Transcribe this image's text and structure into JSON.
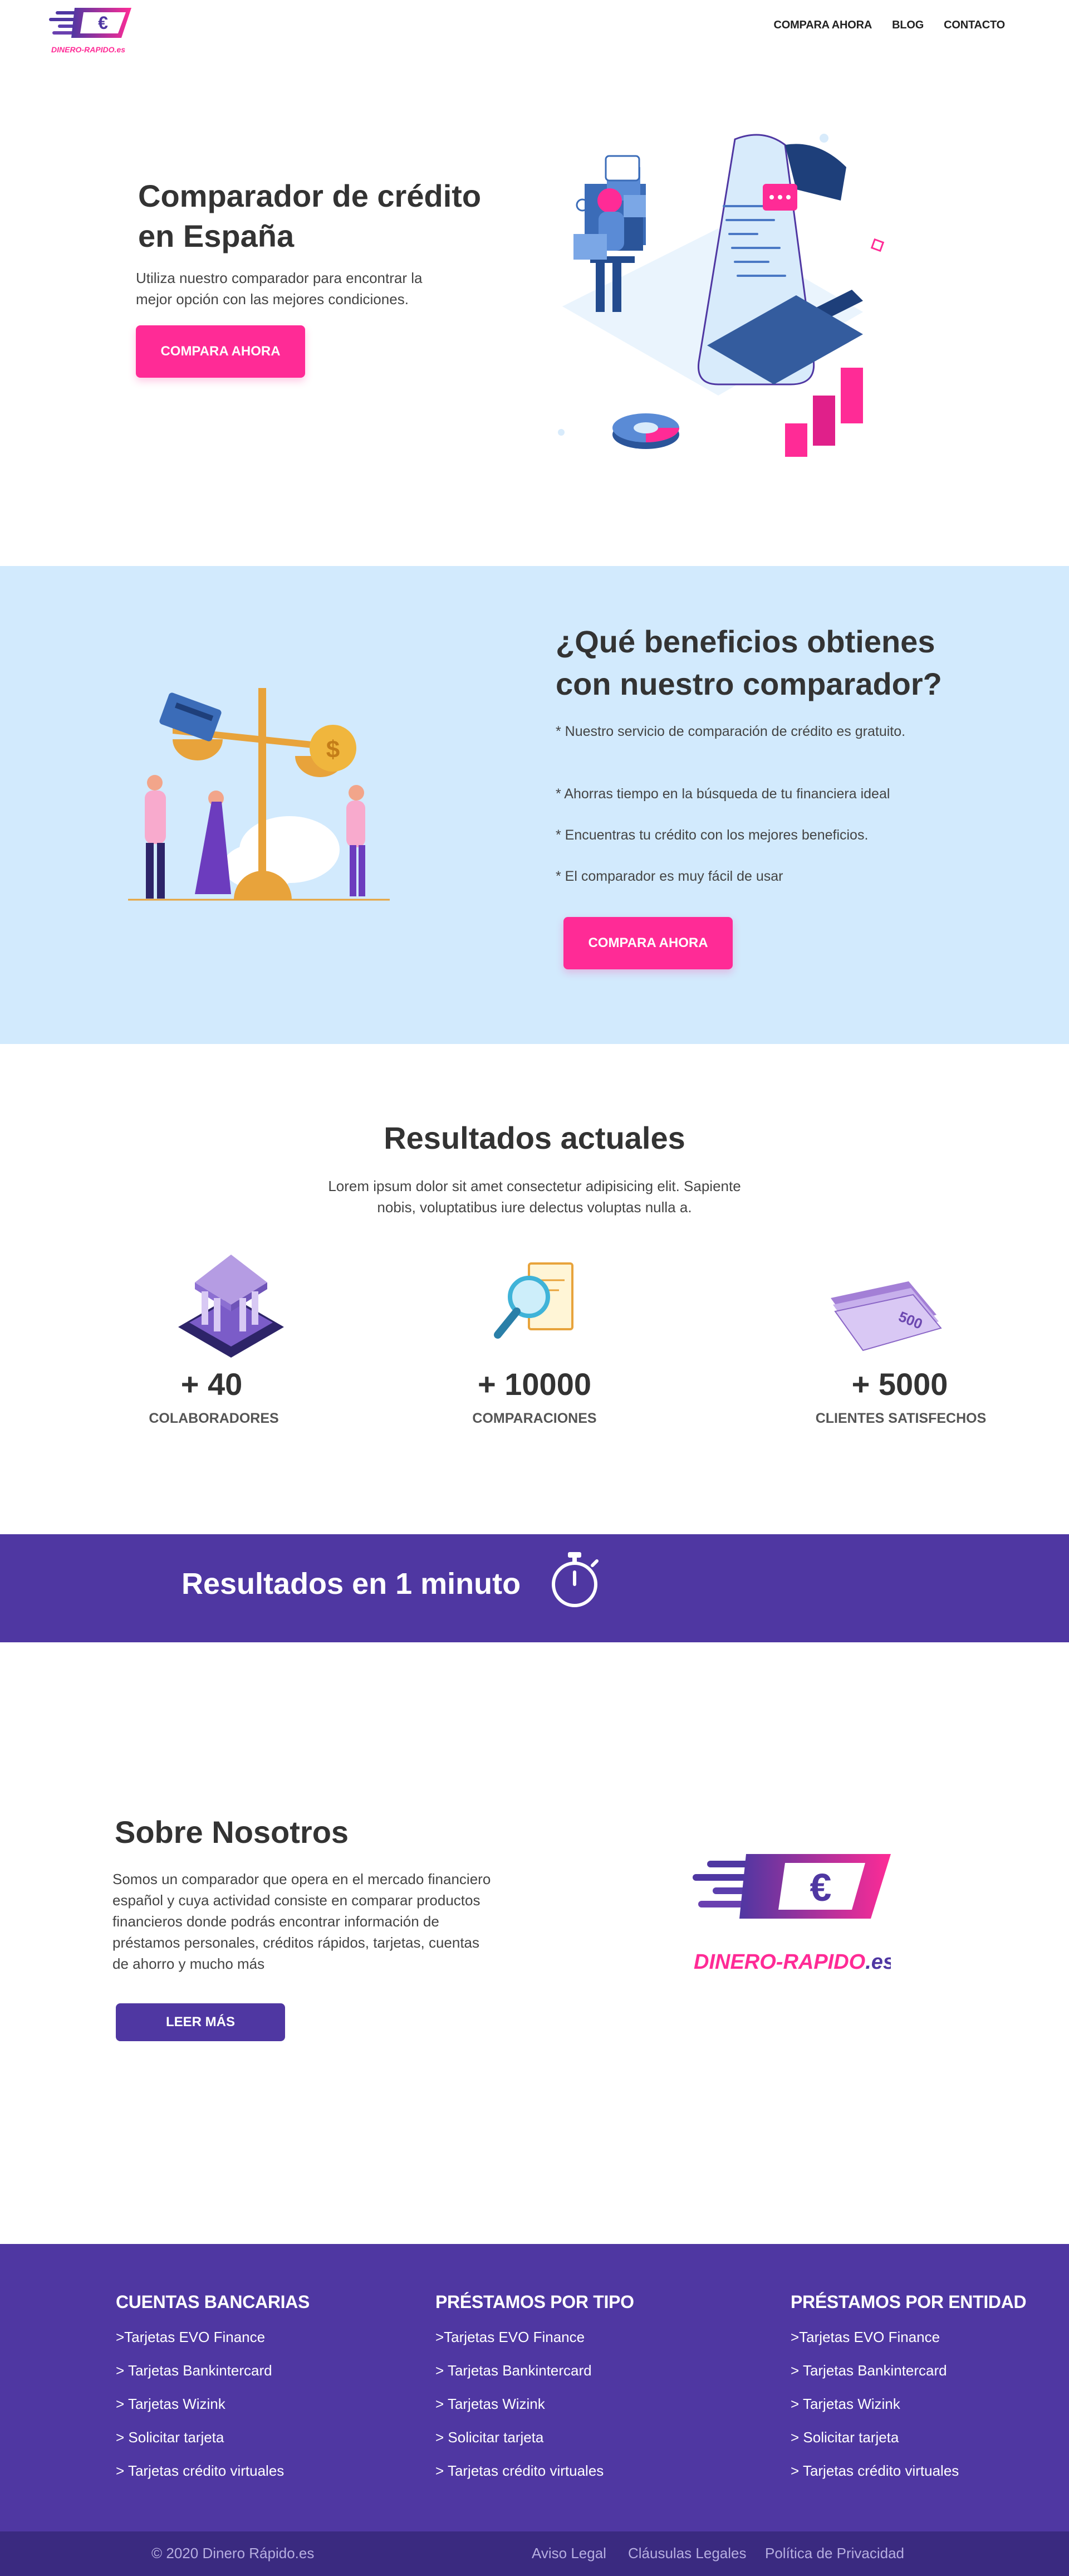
{
  "brand": {
    "name": "DINERO-RAPIDO.es",
    "pink": "#ff2b96",
    "purple": "#4f37a2",
    "light_blue": "#d2eafd",
    "euro_symbol": "€"
  },
  "nav": {
    "items": [
      "COMPARA AHORA",
      "BLOG",
      "CONTACTO"
    ]
  },
  "hero": {
    "title": "Comparador de crédito en España",
    "description": "Utiliza nuestro comparador para encontrar la mejor opción con las mejores condiciones.",
    "cta": "COMPARA AHORA"
  },
  "benefits": {
    "title": "¿Qué beneficios obtienes con nuestro comparador?",
    "items": [
      "* Nuestro servicio de comparación de crédito es gratuito.",
      "* Ahorras tiempo en la búsqueda de tu financiera ideal",
      "* Encuentras tu crédito con los mejores beneficios.",
      "* El comparador es muy fácil de usar"
    ],
    "cta": "COMPARA AHORA"
  },
  "results": {
    "title": "Resultados actuales",
    "description": "Lorem ipsum dolor sit amet consectetur adipisicing elit. Sapiente nobis, voluptatibus iure delectus voluptas nulla a.",
    "stats": [
      {
        "number": "+ 40",
        "label": "COLABORADORES",
        "icon": "bank-icon"
      },
      {
        "number": "+ 10000",
        "label": "COMPARACIONES",
        "icon": "magnifier-document-icon"
      },
      {
        "number": "+ 5000",
        "label": "CLIENTES SATISFECHOS",
        "icon": "banknotes-icon"
      }
    ],
    "note_value": "500"
  },
  "banner": {
    "text": "Resultados en 1 minuto",
    "icon": "stopwatch-icon"
  },
  "about": {
    "title": "Sobre Nosotros",
    "description": "Somos un comparador que opera en el mercado financiero español y cuya actividad consiste en comparar productos financieros donde podrás encontrar información de préstamos personales, créditos rápidos, tarjetas, cuentas de ahorro y mucho más",
    "cta": "LEER MÁS",
    "logo_text": "DINERO-RAPIDO",
    "logo_suffix": ".es"
  },
  "footer": {
    "columns": [
      {
        "title": "CUENTAS BANCARIAS",
        "links": [
          ">Tarjetas EVO Finance",
          "> Tarjetas Bankintercard",
          "> Tarjetas Wizink",
          "> Solicitar tarjeta",
          "> Tarjetas crédito virtuales"
        ]
      },
      {
        "title": "PRÉSTAMOS POR TIPO",
        "links": [
          ">Tarjetas EVO Finance",
          "> Tarjetas Bankintercard",
          "> Tarjetas Wizink",
          "> Solicitar tarjeta",
          "> Tarjetas crédito virtuales"
        ]
      },
      {
        "title": "PRÉSTAMOS POR ENTIDAD",
        "links": [
          ">Tarjetas EVO Finance",
          "> Tarjetas Bankintercard",
          "> Tarjetas Wizink",
          "> Solicitar tarjeta",
          "> Tarjetas crédito virtuales"
        ]
      }
    ],
    "copyright": "© 2020 Dinero Rápido.es",
    "legal_links": [
      "Aviso Legal",
      "Cláusulas Legales",
      "Política de Privacidad"
    ]
  }
}
